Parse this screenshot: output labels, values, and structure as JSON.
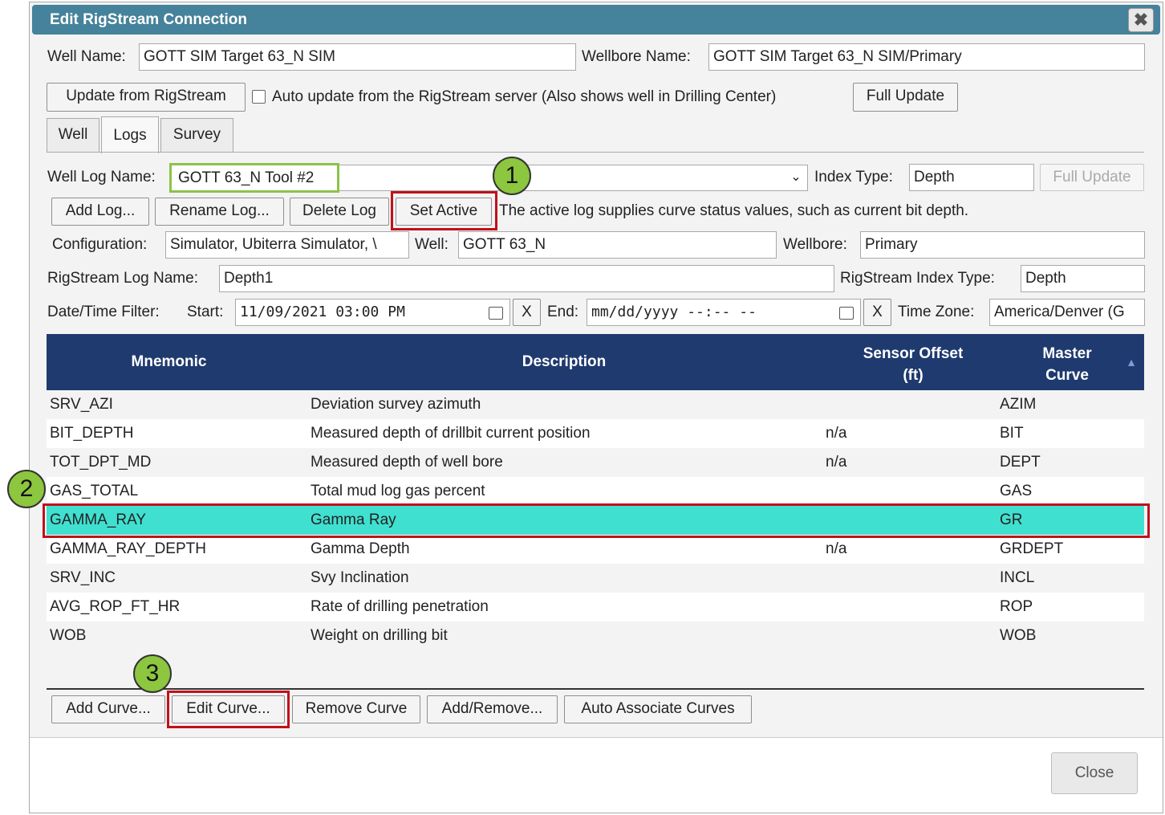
{
  "dialog": {
    "title": "Edit RigStream Connection",
    "close_glyph": "✖"
  },
  "well_row": {
    "well_name_label": "Well Name:",
    "well_name_value": "GOTT SIM Target 63_N SIM",
    "wellbore_name_label": "Wellbore Name:",
    "wellbore_name_value": "GOTT SIM Target 63_N SIM/Primary"
  },
  "update_row": {
    "update_button": "Update from RigStream",
    "auto_update_label": "Auto update from the RigStream server (Also shows well in Drilling Center)",
    "auto_update_checked": false,
    "full_update_button": "Full Update"
  },
  "tabs": [
    {
      "label": "Well",
      "active": false
    },
    {
      "label": "Logs",
      "active": true
    },
    {
      "label": "Survey",
      "active": false
    }
  ],
  "log_section": {
    "well_log_name_label": "Well Log Name:",
    "well_log_name_value": "GOTT 63_N Tool #2",
    "index_type_label": "Index Type:",
    "index_type_value": "Depth",
    "full_update_button": "Full Update",
    "add_log_button": "Add Log...",
    "rename_log_button": "Rename Log...",
    "delete_log_button": "Delete Log",
    "set_active_button": "Set Active",
    "active_log_note": "The active log supplies curve status values, such as current bit depth.",
    "configuration_label": "Configuration:",
    "configuration_value": "Simulator, Ubiterra Simulator, \\",
    "well_label": "Well:",
    "well_value": "GOTT 63_N",
    "wellbore_label": "Wellbore:",
    "wellbore_value": "Primary",
    "rigstream_log_name_label": "RigStream Log Name:",
    "rigstream_log_name_value": "Depth1",
    "rigstream_index_type_label": "RigStream Index Type:",
    "rigstream_index_type_value": "Depth",
    "datetime_filter_label": "Date/Time Filter:",
    "start_label": "Start:",
    "start_value": "11/09/2021  03:00  PM",
    "clear_start": "X",
    "end_label": "End:",
    "end_value": "mm/dd/yyyy  --:--  --",
    "clear_end": "X",
    "time_zone_label": "Time Zone:",
    "time_zone_value": "America/Denver (G"
  },
  "table": {
    "headers": {
      "mnemonic": "Mnemonic",
      "description": "Description",
      "sensor_offset_1": "Sensor Offset",
      "sensor_offset_2": "(ft)",
      "master_curve_1": "Master",
      "master_curve_2": "Curve",
      "sort_glyph": "▲"
    },
    "rows": [
      {
        "mnemonic": "SRV_AZI",
        "description": "Deviation survey azimuth",
        "offset": "",
        "master": "AZIM"
      },
      {
        "mnemonic": "BIT_DEPTH",
        "description": "Measured depth of drillbit current position",
        "offset": "n/a",
        "master": "BIT"
      },
      {
        "mnemonic": "TOT_DPT_MD",
        "description": "Measured depth of well bore",
        "offset": "n/a",
        "master": "DEPT"
      },
      {
        "mnemonic": "GAS_TOTAL",
        "description": "Total mud log gas percent",
        "offset": "",
        "master": "GAS"
      },
      {
        "mnemonic": "GAMMA_RAY",
        "description": "Gamma Ray",
        "offset": "",
        "master": "GR"
      },
      {
        "mnemonic": "GAMMA_RAY_DEPTH",
        "description": "Gamma Depth",
        "offset": "n/a",
        "master": "GRDEPT"
      },
      {
        "mnemonic": "SRV_INC",
        "description": "Svy Inclination",
        "offset": "",
        "master": "INCL"
      },
      {
        "mnemonic": "AVG_ROP_FT_HR",
        "description": "Rate of drilling penetration",
        "offset": "",
        "master": "ROP"
      },
      {
        "mnemonic": "WOB",
        "description": "Weight on drilling bit",
        "offset": "",
        "master": "WOB"
      }
    ],
    "selected_row": "GAMMA_RAY",
    "selected_color": "#40e0d0"
  },
  "curve_buttons": {
    "add_curve": "Add Curve...",
    "edit_curve": "Edit Curve...",
    "remove_curve": "Remove Curve",
    "add_remove": "Add/Remove...",
    "auto_associate": "Auto Associate Curves"
  },
  "footer": {
    "close_button": "Close"
  },
  "annotations": {
    "step1": "1",
    "step2": "2",
    "step3": "3",
    "badge_color": "#8dc63f",
    "highlight_color": "#c1111a"
  },
  "colors": {
    "title_bar": "#45829b",
    "table_header": "#1f3a6e"
  }
}
